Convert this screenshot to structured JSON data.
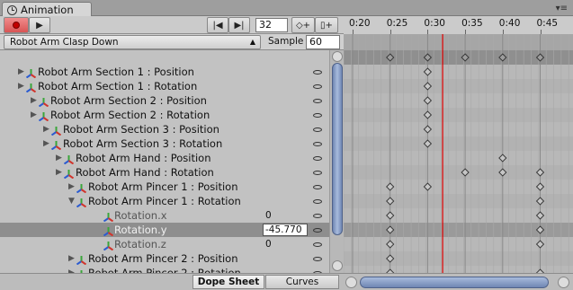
{
  "window": {
    "tab_title": "Animation"
  },
  "toolbar": {
    "frame": "32"
  },
  "ruler": {
    "ticks": [
      "0:20",
      "0:25",
      "0:30",
      "0:35",
      "0:40",
      "0:45"
    ]
  },
  "clip": {
    "name": "Robot Arm Clasp Down",
    "sample_label": "Sample",
    "sample_value": "60"
  },
  "properties": [
    {
      "name": "Robot Arm Section 1 : Position",
      "depth": 0,
      "expanded": false
    },
    {
      "name": "Robot Arm Section 1 : Rotation",
      "depth": 0,
      "expanded": false
    },
    {
      "name": "Robot Arm Section 2 : Position",
      "depth": 1,
      "expanded": false
    },
    {
      "name": "Robot Arm Section 2 : Rotation",
      "depth": 1,
      "expanded": false
    },
    {
      "name": "Robot Arm Section 3 : Position",
      "depth": 2,
      "expanded": false
    },
    {
      "name": "Robot Arm Section 3 : Rotation",
      "depth": 2,
      "expanded": false
    },
    {
      "name": "Robot Arm Hand : Position",
      "depth": 3,
      "expanded": false
    },
    {
      "name": "Robot Arm Hand : Rotation",
      "depth": 3,
      "expanded": false
    },
    {
      "name": "Robot Arm Pincer 1 : Position",
      "depth": 4,
      "expanded": false
    },
    {
      "name": "Robot Arm Pincer 1 : Rotation",
      "depth": 4,
      "expanded": true
    },
    {
      "name": "Rotation.x",
      "depth": 5,
      "sub": true,
      "value": "0"
    },
    {
      "name": "Rotation.y",
      "depth": 5,
      "sub": true,
      "value": "-45.770",
      "selected": true,
      "editing": true
    },
    {
      "name": "Rotation.z",
      "depth": 5,
      "sub": true,
      "value": "0"
    },
    {
      "name": "Robot Arm Pincer 2 : Position",
      "depth": 4,
      "expanded": false
    },
    {
      "name": "Robot Arm Pincer 2 : Rotation",
      "depth": 4,
      "expanded": false
    }
  ],
  "bottom_tabs": {
    "dope_sheet": "Dope Sheet",
    "curves": "Curves"
  },
  "keyframes": {
    "summary": [
      0.25,
      0.3,
      0.35,
      0.4,
      0.45
    ],
    "rows": [
      [
        0.3
      ],
      [
        0.3
      ],
      [
        0.3
      ],
      [
        0.3
      ],
      [
        0.3
      ],
      [
        0.3
      ],
      [
        0.4
      ],
      [
        0.35,
        0.4,
        0.45
      ],
      [
        0.25,
        0.3,
        0.45
      ],
      [
        0.25,
        0.45
      ],
      [
        0.25,
        0.45
      ],
      [
        0.25,
        0.45
      ],
      [
        0.25,
        0.45
      ],
      [
        0.25
      ],
      [
        0.25,
        0.45
      ]
    ]
  },
  "playhead_time": 0.32,
  "colors": {
    "playhead": "#e00000",
    "selection": "#8e8e8e",
    "scroll_thumb": "#8aa0c8"
  }
}
